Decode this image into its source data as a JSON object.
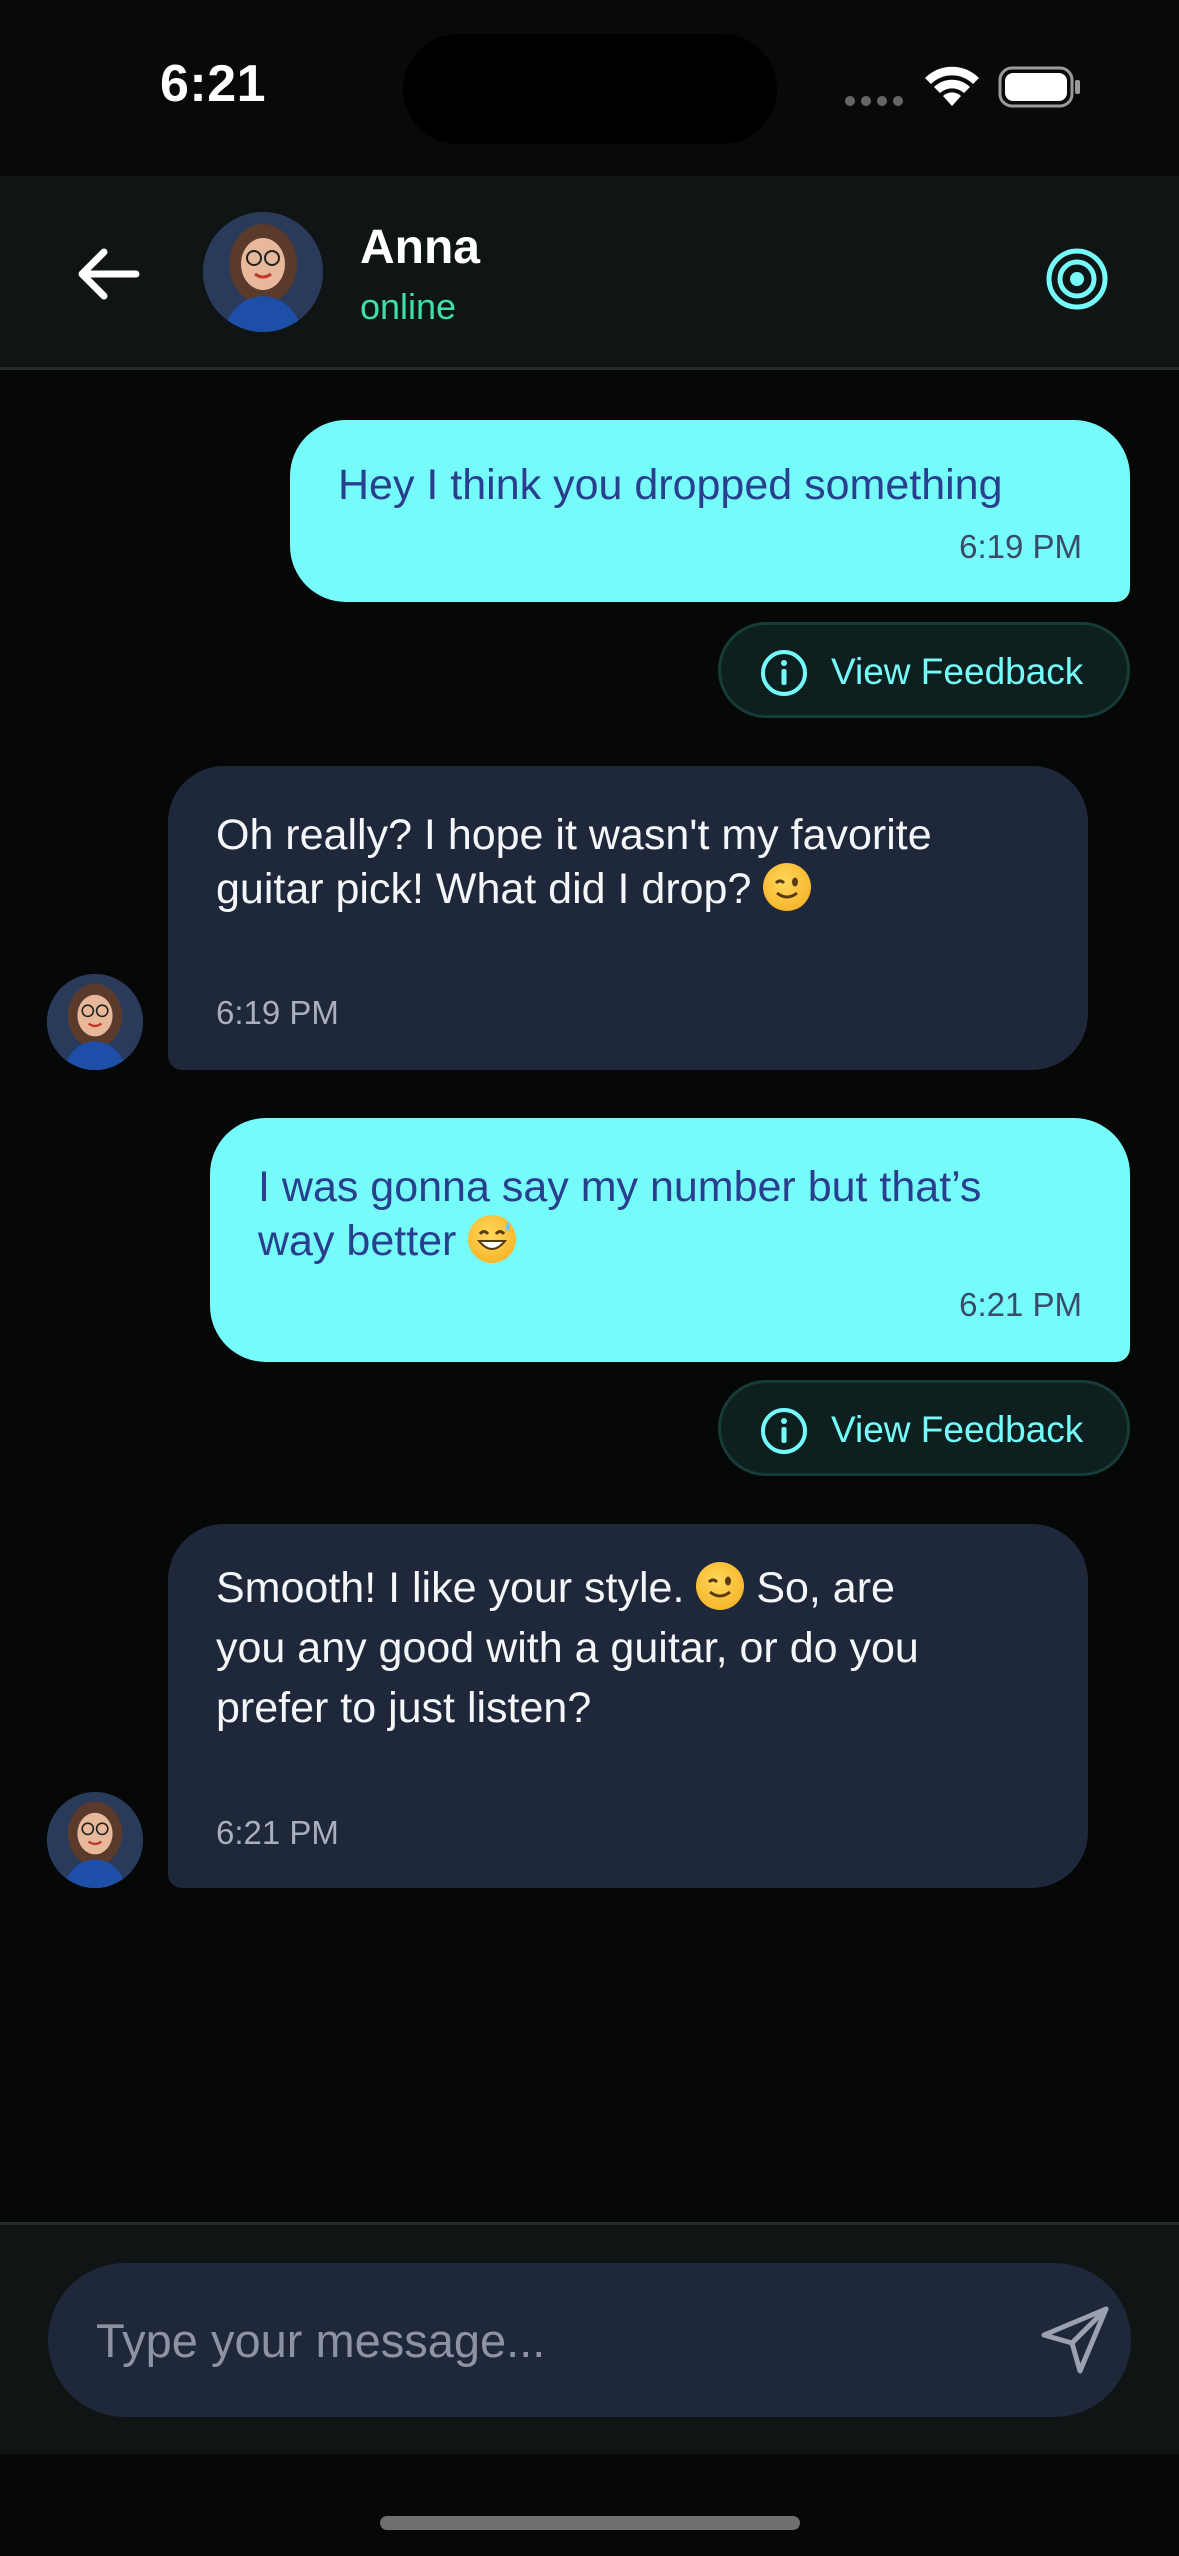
{
  "status_bar": {
    "time": "6:21"
  },
  "header": {
    "contact_name": "Anna",
    "contact_status": "online",
    "avatar_icon": "avatar-photo",
    "back_icon": "arrow-left-icon",
    "action_icon": "target-icon"
  },
  "messages": [
    {
      "direction": "sent",
      "text": "Hey I think you dropped something",
      "time": "6:19 PM",
      "feedback_label": "View Feedback"
    },
    {
      "direction": "received",
      "text_line1": "Oh really? I hope it wasn't my favorite",
      "text_line2": "guitar pick! What did I drop?",
      "emoji": "winking-face",
      "time": "6:19 PM"
    },
    {
      "direction": "sent",
      "text_line1": "I was gonna say my number but that’s",
      "text_line2": "way better",
      "emoji": "grinning-face-with-sweat",
      "time": "6:21 PM",
      "feedback_label": "View Feedback"
    },
    {
      "direction": "received",
      "text_line1a": "Smooth! I like your style.",
      "emoji": "winking-face",
      "text_line1b": "So, are",
      "text_line2": "you any good with a guitar, or do you",
      "text_line3": "prefer to just listen?",
      "time": "6:21 PM"
    }
  ],
  "composer": {
    "placeholder": "Type your message...",
    "send_icon": "paper-plane-icon"
  },
  "colors": {
    "accent": "#76fbfb",
    "online": "#3ee0a6",
    "received_bubble": "#1f283a",
    "sent_text": "#2a3e8e"
  }
}
